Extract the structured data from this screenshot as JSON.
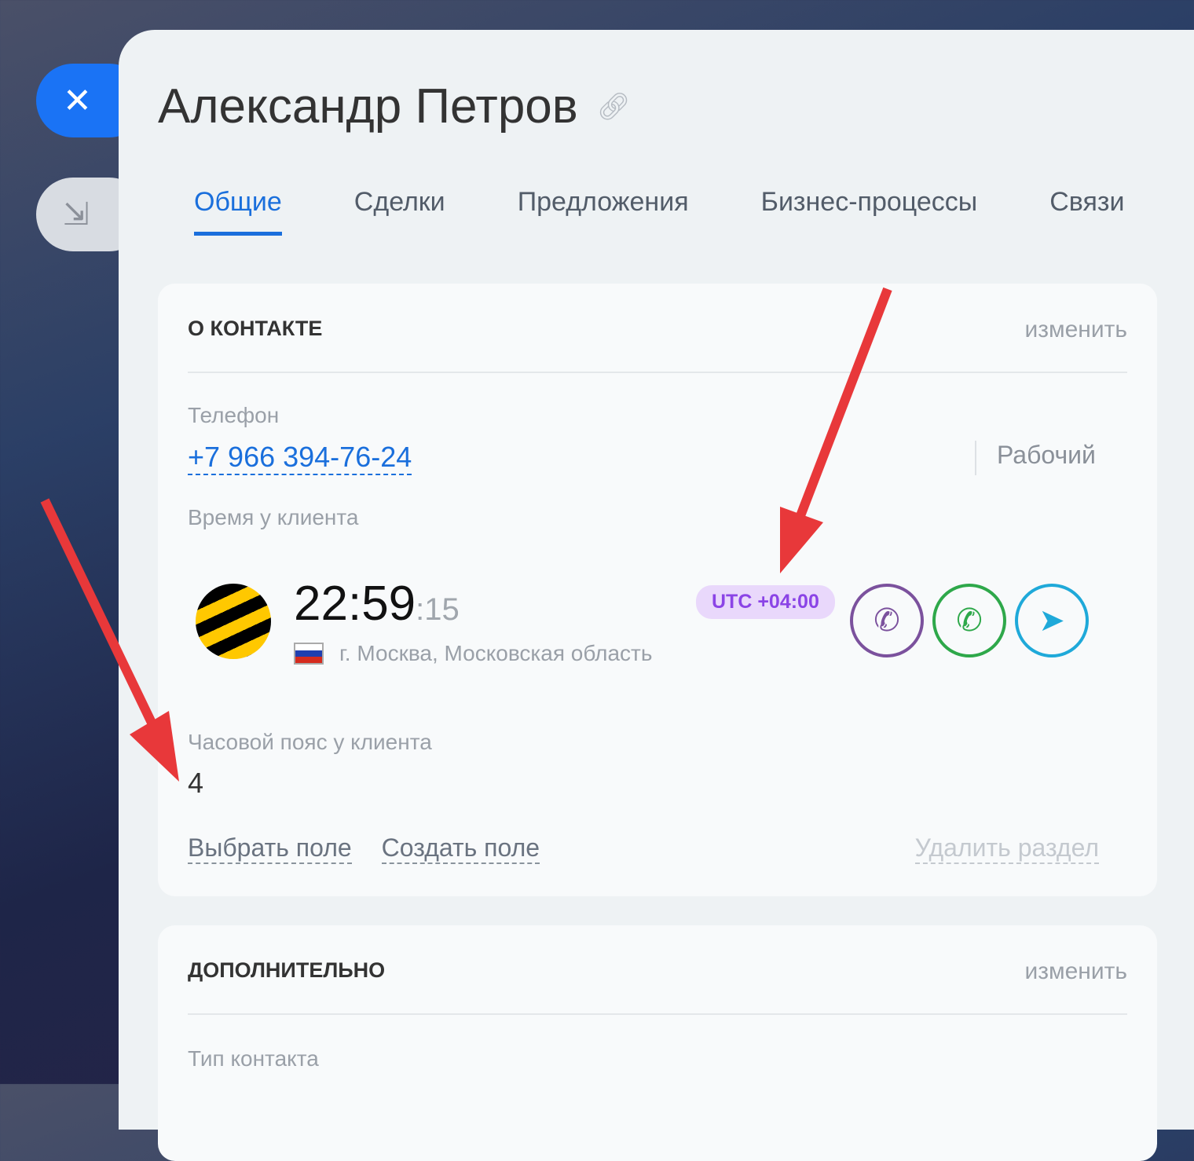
{
  "window": {
    "close_icon": "close-icon",
    "minimize_icon": "minimize-icon"
  },
  "header": {
    "title": "Александр Петров"
  },
  "tabs": [
    {
      "label": "Общие"
    },
    {
      "label": "Сделки"
    },
    {
      "label": "Предложения"
    },
    {
      "label": "Бизнес-процессы"
    },
    {
      "label": "Связи"
    }
  ],
  "about": {
    "title": "О КОНТАКТЕ",
    "edit": "изменить",
    "phone_label": "Телефон",
    "phone": "+7 966 394-76-24",
    "phone_type": "Рабочий",
    "time_label": "Время у клиента",
    "time": "22:59",
    "seconds": ":15",
    "city": "г. Москва, Московская область",
    "utc": "UTC +04:00",
    "tz_label": "Часовой пояс у клиента",
    "tz_value": "4",
    "select_field": "Выбрать поле",
    "create_field": "Создать поле",
    "delete_section": "Удалить раздел"
  },
  "extra": {
    "title": "ДОПОЛНИТЕЛЬНО",
    "edit": "изменить",
    "type_label": "Тип контакта"
  },
  "colors": {
    "accent": "#1a6fdc",
    "viber": "#7b519d",
    "whatsapp": "#2ea84a",
    "telegram": "#1fa9d9",
    "arrow": "#e8383a"
  }
}
